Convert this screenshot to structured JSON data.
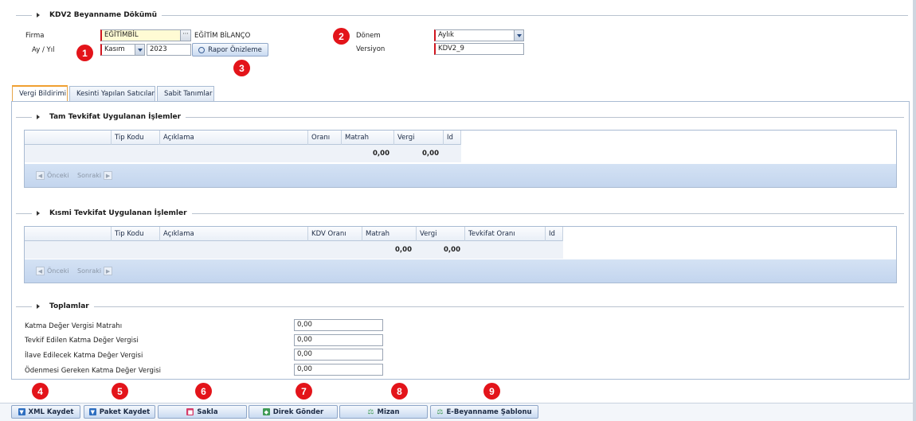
{
  "header": {
    "title": "KDV2 Beyanname Dökümü"
  },
  "form": {
    "firma_label": "Firma",
    "firma_value": "EĞİTİMBİL",
    "firma_desc": "EĞİTİM BİLANÇO",
    "ay_yil_label": "Ay / Yıl",
    "ay_value": "Kasım",
    "yil_value": "2023",
    "rapor_button": "Rapor Önizleme",
    "donem_label": "Dönem",
    "donem_value": "Aylık",
    "versiyon_label": "Versiyon",
    "versiyon_value": "KDV2_9"
  },
  "badges": [
    "1",
    "2",
    "3",
    "4",
    "5",
    "6",
    "7",
    "8",
    "9"
  ],
  "tabs": [
    "Vergi Bildirimi",
    "Kesinti Yapılan Satıcılar",
    "Sabit Tanımlar"
  ],
  "section1": {
    "title": "Tam Tevkifat Uygulanan İşlemler",
    "columns": [
      "",
      "Tip Kodu",
      "Açıklama",
      "Oranı",
      "Matrah",
      "Vergi",
      "Id"
    ],
    "sums": {
      "matrah": "0,00",
      "vergi": "0,00"
    },
    "pager": {
      "prev": "Önceki",
      "next": "Sonraki"
    }
  },
  "section2": {
    "title": "Kısmi Tevkifat Uygulanan İşlemler",
    "columns": [
      "",
      "Tip Kodu",
      "Açıklama",
      "KDV Oranı",
      "Matrah",
      "Vergi",
      "Tevkifat Oranı",
      "Id"
    ],
    "sums": {
      "matrah": "0,00",
      "vergi": "0,00"
    },
    "pager": {
      "prev": "Önceki",
      "next": "Sonraki"
    }
  },
  "totals": {
    "title": "Toplamlar",
    "rows": [
      {
        "label": "Katma Değer Vergisi Matrahı",
        "value": "0,00"
      },
      {
        "label": "Tevkif Edilen Katma Değer Vergisi",
        "value": "0,00"
      },
      {
        "label": "İlave Edilecek Katma Değer Vergisi",
        "value": "0,00"
      },
      {
        "label": "Ödenmesi Gereken Katma Değer Vergisi",
        "value": "0,00"
      }
    ]
  },
  "toolbar": {
    "xml": "XML Kaydet",
    "paket": "Paket Kaydet",
    "sakla": "Sakla",
    "direk": "Direk Gönder",
    "mizan": "Mizan",
    "ebeyanname": "E-Beyanname Şablonu"
  },
  "icons": {
    "download": "download-icon",
    "save": "floppy-icon",
    "send": "send-icon",
    "mizan": "scale-icon"
  },
  "colors": {
    "badge": "#e3141a",
    "required": "#d0151e",
    "active_tab": "#f0a030"
  }
}
